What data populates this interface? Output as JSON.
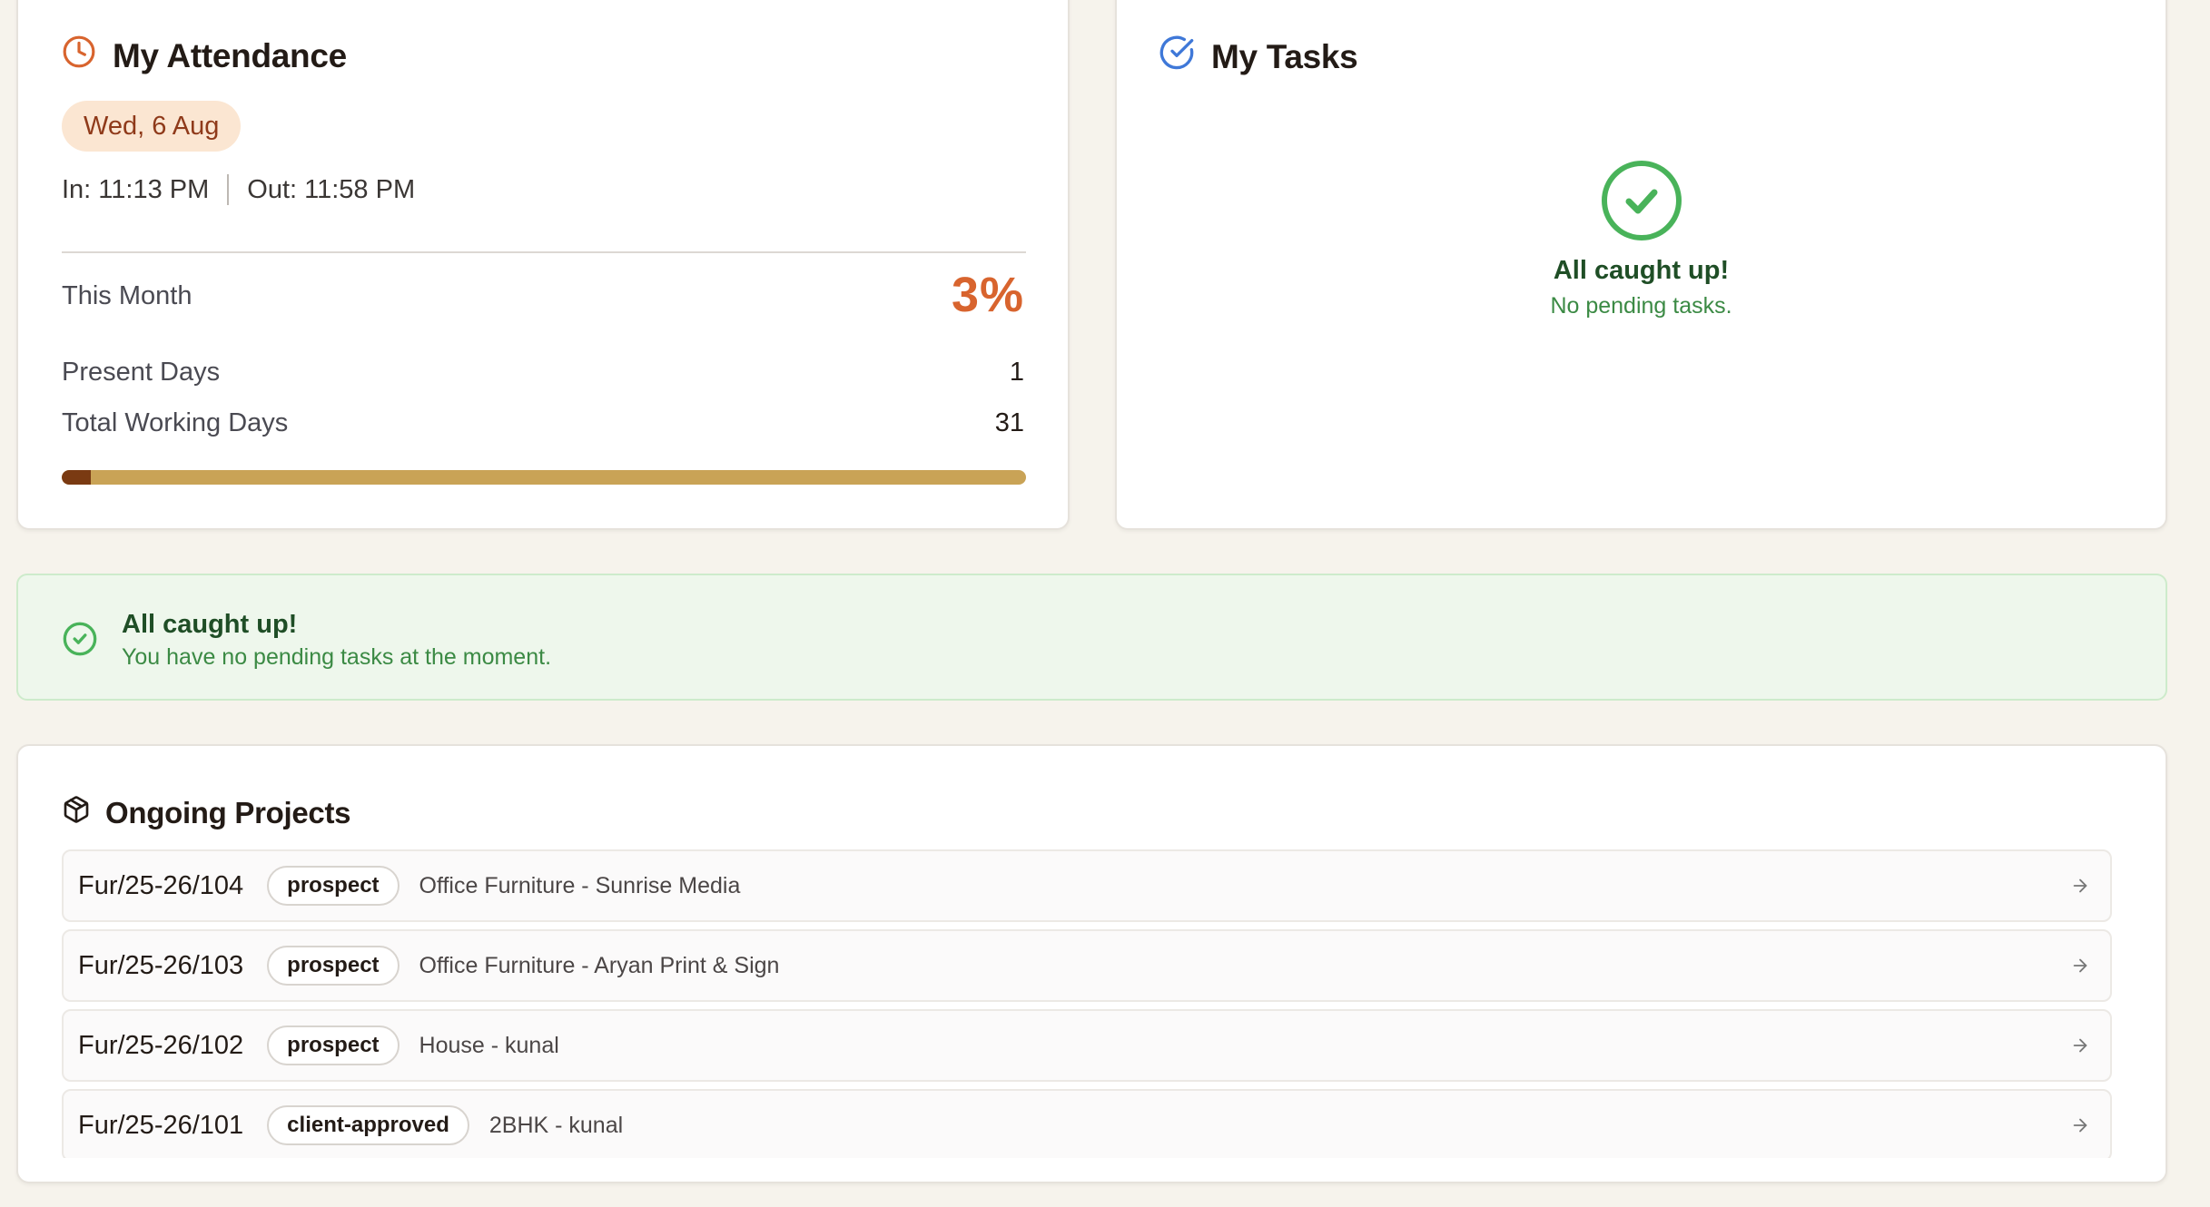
{
  "attendance": {
    "title": "My Attendance",
    "date": "Wed, 6 Aug",
    "in_label": "In: 11:13 PM",
    "out_label": "Out: 11:58 PM",
    "this_month_label": "This Month",
    "this_month_pct": "3%",
    "present_days_label": "Present Days",
    "present_days_value": "1",
    "total_working_days_label": "Total Working Days",
    "total_working_days_value": "31",
    "progress_fraction": 0.03,
    "icon": "clock-icon",
    "colors": {
      "accent": "#d8642e",
      "pill_bg": "#fbe6d2",
      "pill_text": "#8f3a1a",
      "track": "#c9a356",
      "fill": "#7a3a12"
    }
  },
  "tasks": {
    "title": "My Tasks",
    "icon": "check-circle-icon",
    "empty_title": "All caught up!",
    "empty_subtitle": "No pending tasks.",
    "colors": {
      "title_icon": "#3f78d8",
      "success": "#49b35a"
    }
  },
  "banner": {
    "title": "All caught up!",
    "subtitle": "You have no pending tasks at the moment.",
    "icon": "check-circle-icon"
  },
  "projects": {
    "title": "Ongoing Projects",
    "icon": "package-icon",
    "items": [
      {
        "id": "Fur/25-26/104",
        "status": "prospect",
        "name": "Office Furniture - Sunrise Media"
      },
      {
        "id": "Fur/25-26/103",
        "status": "prospect",
        "name": "Office Furniture - Aryan Print & Sign"
      },
      {
        "id": "Fur/25-26/102",
        "status": "prospect",
        "name": "House - kunal"
      },
      {
        "id": "Fur/25-26/101",
        "status": "client-approved",
        "name": "2BHK - kunal"
      }
    ]
  }
}
